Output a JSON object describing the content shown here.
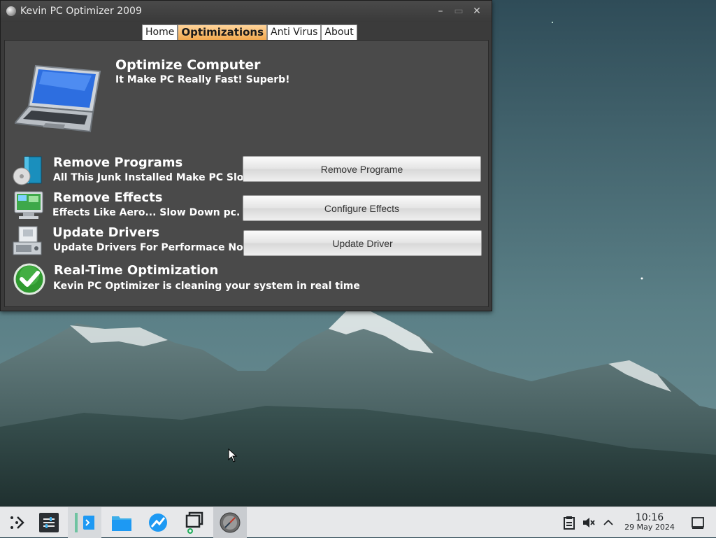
{
  "window": {
    "title": "Kevin PC Optimizer 2009",
    "controls": {
      "minimize": "–",
      "maximize": "▭",
      "close": "✕"
    }
  },
  "tabs": [
    {
      "label": "Home",
      "active": false
    },
    {
      "label": "Optimizations",
      "active": true
    },
    {
      "label": "Anti Virus",
      "active": false
    },
    {
      "label": "About",
      "active": false
    }
  ],
  "hero": {
    "title": "Optimize Computer",
    "subtitle": "It Make PC Really Fast! Superb!"
  },
  "rows": [
    {
      "title": "Remove Programs",
      "description": "All This Junk Installed Make PC Slow",
      "button": "Remove Programe",
      "icon": "software-box-icon"
    },
    {
      "title": "Remove Effects",
      "description": "Effects Like Aero... Slow Down pc.",
      "button": "Configure Effects",
      "icon": "monitor-icon"
    },
    {
      "title": "Update Drivers",
      "description": "Update Drivers For Performace Now",
      "button": "Update Driver",
      "icon": "driver-disk-icon"
    },
    {
      "title": "Real-Time Optimization",
      "description": "Kevin PC Optimizer is cleaning your system in real time",
      "icon": "green-check-icon"
    }
  ],
  "taskbar": {
    "launchers": [
      "application-launcher-icon",
      "system-settings-icon",
      "terminal-icon",
      "file-manager-icon",
      "browser-icon",
      "window-switcher-icon",
      "optimizer-app-icon"
    ],
    "tray": [
      "clipboard-icon",
      "volume-muted-icon",
      "expand-tray-icon",
      "show-desktop-icon"
    ],
    "clock_time": "10:16",
    "clock_date": "29 May 2024"
  },
  "colors": {
    "tab_active": "#f2a84e",
    "window_bg": "#3b3b3b",
    "panel_bg": "#4a4a4a",
    "taskbar_bg": "#e7e8ea"
  }
}
